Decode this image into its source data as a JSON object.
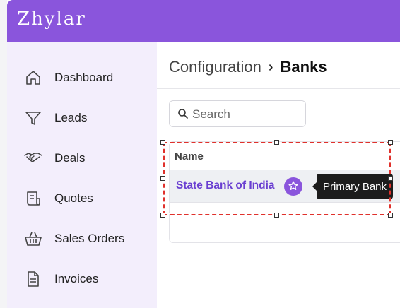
{
  "app": {
    "brand": "Zhylar",
    "accent_color": "#8a55dc",
    "sidebar_bg": "#f3eefc"
  },
  "sidebar": {
    "items": [
      {
        "label": "Dashboard",
        "icon": "home-icon"
      },
      {
        "label": "Leads",
        "icon": "filter-icon"
      },
      {
        "label": "Deals",
        "icon": "handshake-icon"
      },
      {
        "label": "Quotes",
        "icon": "receipt-icon"
      },
      {
        "label": "Sales Orders",
        "icon": "basket-icon"
      },
      {
        "label": "Invoices",
        "icon": "document-icon"
      }
    ]
  },
  "breadcrumb": {
    "root": "Configuration",
    "separator": "›",
    "current": "Banks"
  },
  "search": {
    "placeholder": "Search",
    "value": ""
  },
  "table": {
    "columns": [
      "Name"
    ],
    "rows": [
      {
        "name": "State Bank of India",
        "badge_icon": "star-icon",
        "tooltip": "Primary Bank"
      }
    ]
  },
  "selection": {
    "color": "#e0312c",
    "style": "dashed"
  }
}
